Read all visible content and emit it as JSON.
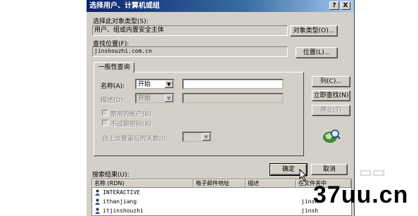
{
  "dialog": {
    "title": "选择用户、计算机或组",
    "help_button": "?",
    "close_button": "X"
  },
  "object_type": {
    "label": "选择此对象类型(S):",
    "value": "用户、组或内置安全主体",
    "button": "对象类型(O)..."
  },
  "location": {
    "label": "查找位置(F):",
    "value": "jinshouzhi.com.cn",
    "button": "位置(L)..."
  },
  "query_tab": {
    "label": "一般性查询",
    "name_label": "名称(A):",
    "name_mode": "开始",
    "desc_label": "描述(D):",
    "desc_mode": "开始",
    "disabled_accounts": "禁用的帐户(B)",
    "non_expiring": "不过期密码(X)",
    "days_label": "自上次登录后的天数(I):"
  },
  "side_buttons": {
    "columns": "列(C)...",
    "find_now": "立即查找(N)",
    "stop": "停止(T)"
  },
  "actions": {
    "ok": "确定",
    "cancel": "取消"
  },
  "results": {
    "label": "搜索结果(U):",
    "columns": [
      "名称 (RDN)",
      "电子邮件地址",
      "描述",
      "在文件夹中"
    ],
    "rows": [
      {
        "name": "INTERACTIVE",
        "folder": ""
      },
      {
        "name": "ithanjiang",
        "folder": "jinsh"
      },
      {
        "name": "itjinshouzhi",
        "folder": "jinsh"
      }
    ]
  },
  "watermark": {
    "text": "37uu.cn"
  },
  "colors": {
    "dialog_bg": "#d4d0c8",
    "title_start": "#0a246a",
    "title_end": "#a6caf0"
  }
}
